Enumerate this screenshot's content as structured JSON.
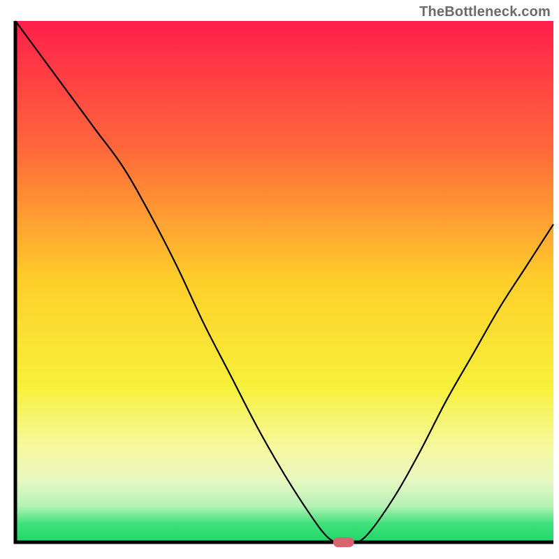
{
  "watermark": "TheBottleneck.com",
  "chart_data": {
    "type": "line",
    "title": "",
    "xlabel": "",
    "ylabel": "",
    "xlim": [
      0,
      100
    ],
    "ylim": [
      0,
      100
    ],
    "x": [
      0,
      5,
      10,
      15,
      20,
      25,
      30,
      35,
      40,
      45,
      50,
      55,
      58,
      60,
      62,
      65,
      70,
      75,
      80,
      85,
      90,
      95,
      100
    ],
    "values": [
      100,
      93,
      86,
      79,
      72,
      63,
      53,
      42,
      32,
      22,
      13,
      5,
      1,
      0,
      0,
      1,
      8,
      17,
      27,
      36,
      45,
      53,
      61
    ],
    "minimum_marker": {
      "x": 61,
      "y": 0
    },
    "curve_note": "V-shaped bottleneck curve with optimum around x≈60; left branch starts at 100, right branch rises to ~61",
    "background_gradient_stops": [
      {
        "pos": 0.0,
        "color": "#ff1f4b"
      },
      {
        "pos": 0.25,
        "color": "#ff6a3a"
      },
      {
        "pos": 0.5,
        "color": "#ffcf2a"
      },
      {
        "pos": 0.7,
        "color": "#f7f03a"
      },
      {
        "pos": 0.82,
        "color": "#f6f9a0"
      },
      {
        "pos": 0.88,
        "color": "#e8f8c2"
      },
      {
        "pos": 0.93,
        "color": "#b6f2b6"
      },
      {
        "pos": 0.965,
        "color": "#3fe07a"
      },
      {
        "pos": 1.0,
        "color": "#1fd66a"
      }
    ],
    "marker_color": "#d9636f",
    "axis_color": "#000000"
  }
}
